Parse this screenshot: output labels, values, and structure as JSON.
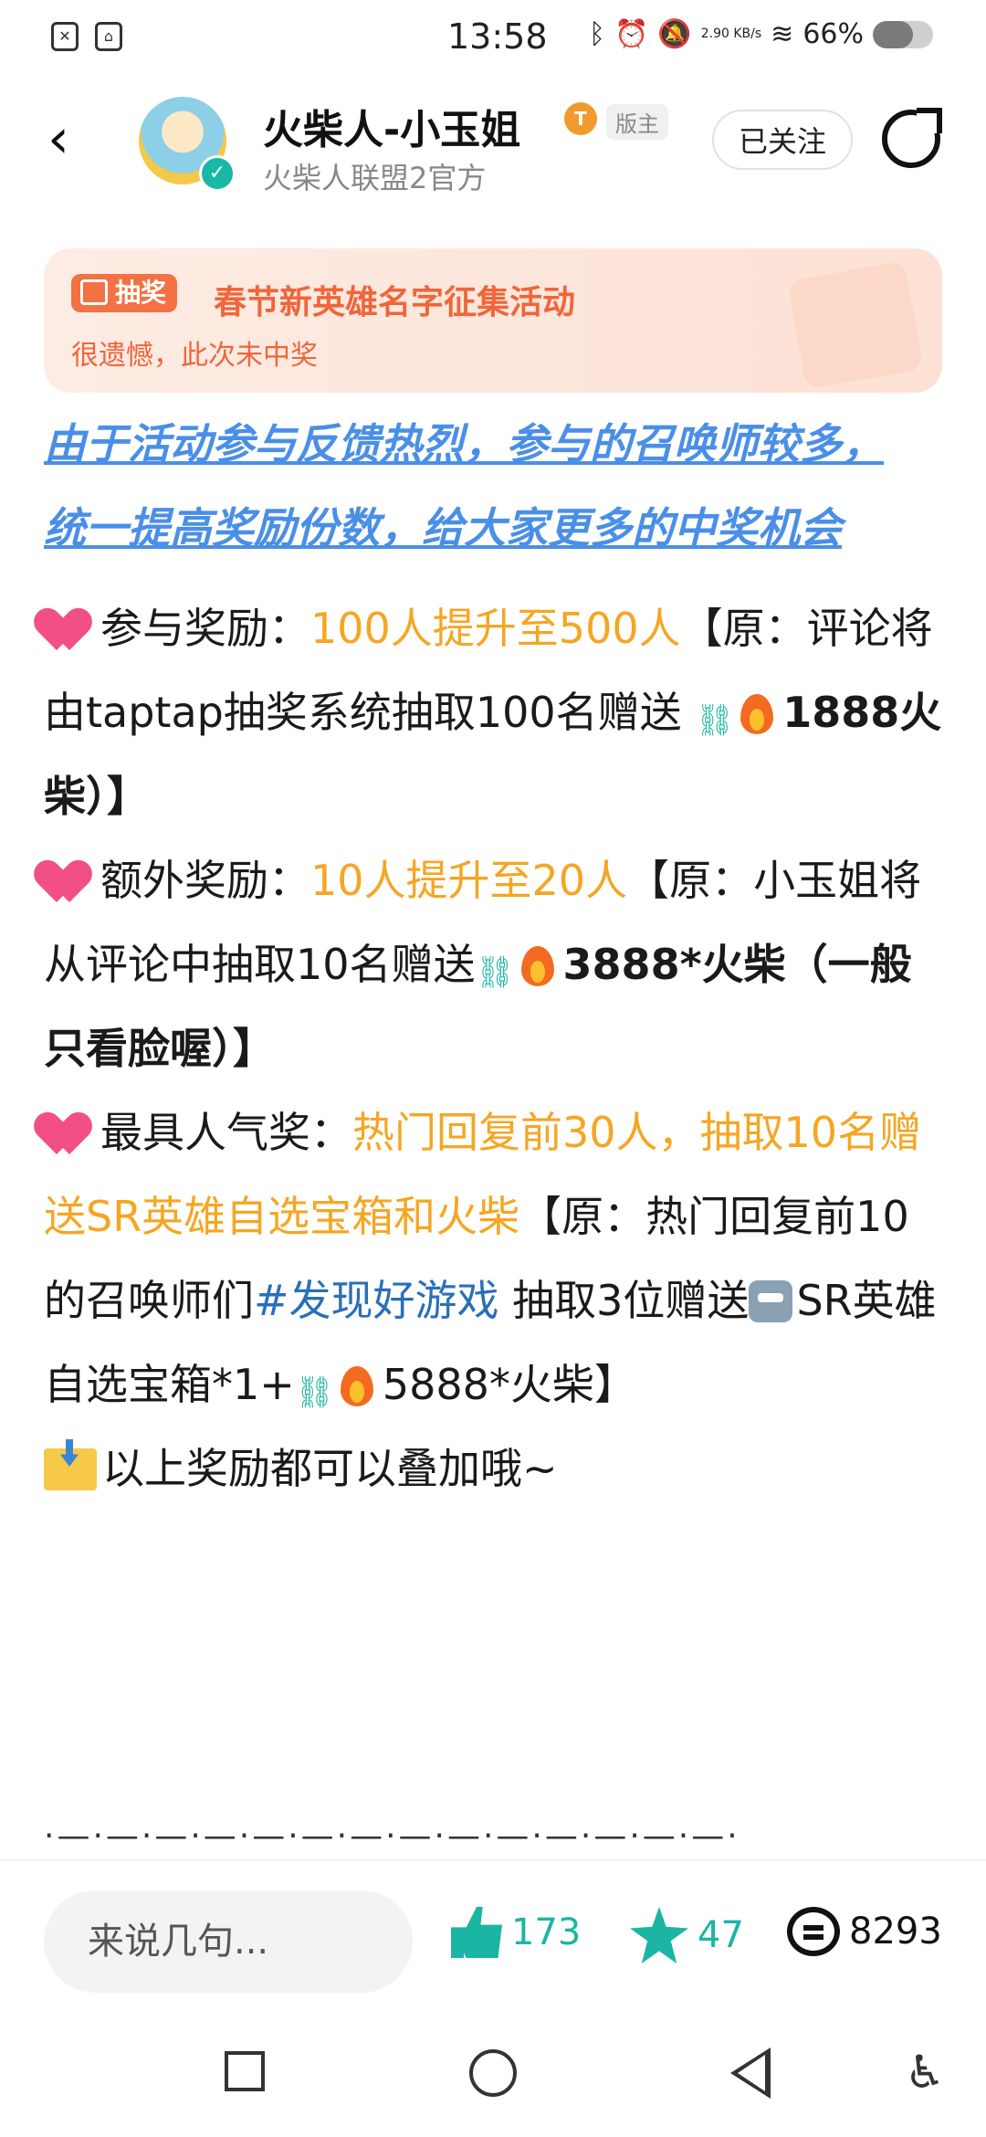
{
  "status": {
    "time": "13:58",
    "speed": "2.90 KB/s",
    "battery": "66%",
    "battery_level": 0.66
  },
  "header": {
    "name": "火柴人-小玉姐",
    "tag_icon": "T",
    "badge": "版主",
    "subtitle": "火柴人联盟2官方",
    "follow_label": "已关注"
  },
  "lottery": {
    "label": "抽奖",
    "title": "春节新英雄名字征集活动",
    "result": "很遗憾，此次未中奖"
  },
  "post": {
    "link_line1": "由于活动参与反馈热烈，参与的召唤师较多，",
    "link_line2": "统一提高奖励份数，给大家更多的中奖机会",
    "p1_label": "参与奖励：",
    "p1_hl": "100人提升至500人",
    "p1_rest": "【原：评论将由taptap抽奖系统抽取100名赠送",
    "p1_amount": "1888火柴）】",
    "p2_label": "额外奖励：",
    "p2_hl": "10人提升至20人",
    "p2_rest": "【原：小玉姐将从评论中抽取10名赠送",
    "p2_amount": "3888*火柴",
    "p2_tail": "（一般只看脸喔）】",
    "p3_label": "最具人气奖：",
    "p3_hl": "热门回复前30人，抽取10名赠送SR英雄自选宝箱和火柴",
    "p3_rest": "【原：热门回复前10的召唤师们",
    "p3_tag": "#发现好游戏",
    "p3_rest2": " 抽取3位赠送",
    "p3_item": "SR英雄自选宝箱*1+",
    "p3_amount": "5888*火柴】",
    "p4": "以上奖励都可以叠加哦~",
    "divider": "·—·—·—·—·—·—·—·—·—·—·—·—·—·—·"
  },
  "bottom": {
    "input_placeholder": "来说几句...",
    "likes": "173",
    "favorites": "47",
    "comments": "8293"
  }
}
